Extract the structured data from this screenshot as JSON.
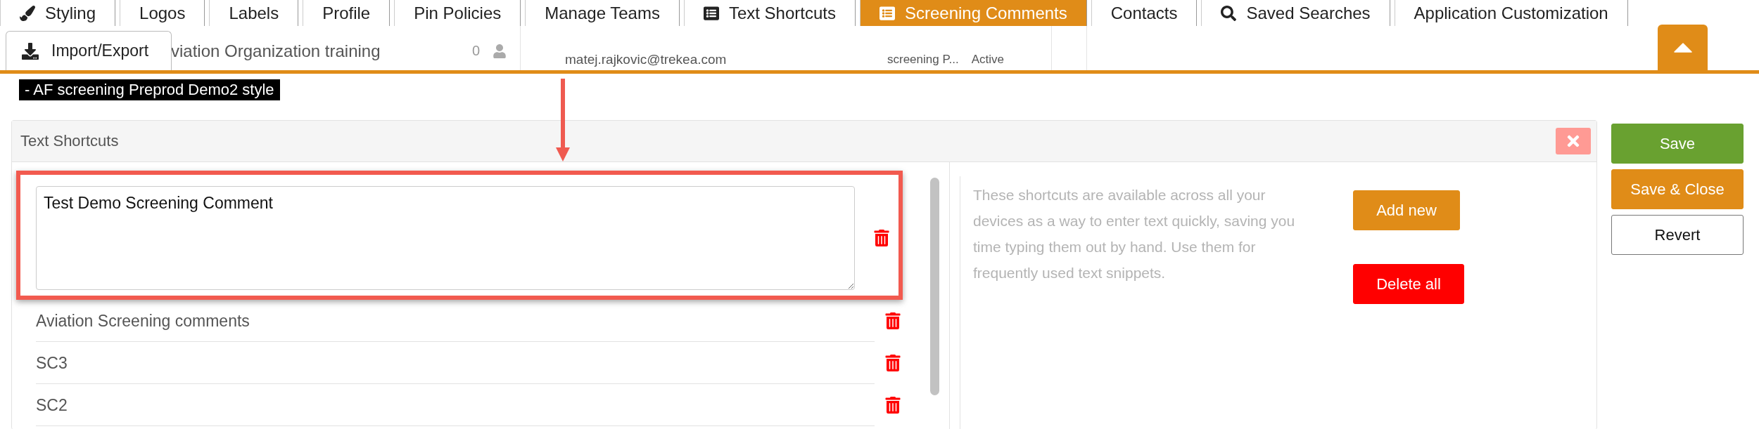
{
  "tabs": [
    {
      "label": "Styling",
      "selected": false
    },
    {
      "label": "Logos",
      "selected": false
    },
    {
      "label": "Labels",
      "selected": false
    },
    {
      "label": "Profile",
      "selected": false
    },
    {
      "label": "Pin Policies",
      "selected": false
    },
    {
      "label": "Manage Teams",
      "selected": false
    },
    {
      "label": "Text Shortcuts",
      "selected": false
    },
    {
      "label": "Screening Comments",
      "selected": true
    },
    {
      "label": "Contacts",
      "selected": false
    },
    {
      "label": "Saved Searches",
      "selected": false
    },
    {
      "label": "Application Customization",
      "selected": false
    }
  ],
  "import_export_button": {
    "label": "Import/Export"
  },
  "background": {
    "organization": "viation Organization training",
    "count": "0",
    "email": "matej.rajkovic@trekea.com",
    "type": "screening P...",
    "status": "Active"
  },
  "style_label": "- AF screening Preprod Demo2 style",
  "panel": {
    "title": "Text Shortcuts",
    "editing": {
      "value": "Test Demo Screening Comment"
    },
    "shortcuts": [
      "Aviation Screening comments",
      "SC3",
      "SC2"
    ],
    "description": "These shortcuts are available across all your devices as a way to enter text quickly, saving you time typing them out by hand. Use them for frequently used text snippets.",
    "buttons": [
      {
        "label": "Add new",
        "kind": "add"
      },
      {
        "label": "Delete all",
        "kind": "delete"
      }
    ]
  },
  "actions": [
    {
      "label": "Save",
      "kind": "save"
    },
    {
      "label": "Save & Close",
      "kind": "save-close"
    },
    {
      "label": "Revert",
      "kind": "revert"
    }
  ]
}
